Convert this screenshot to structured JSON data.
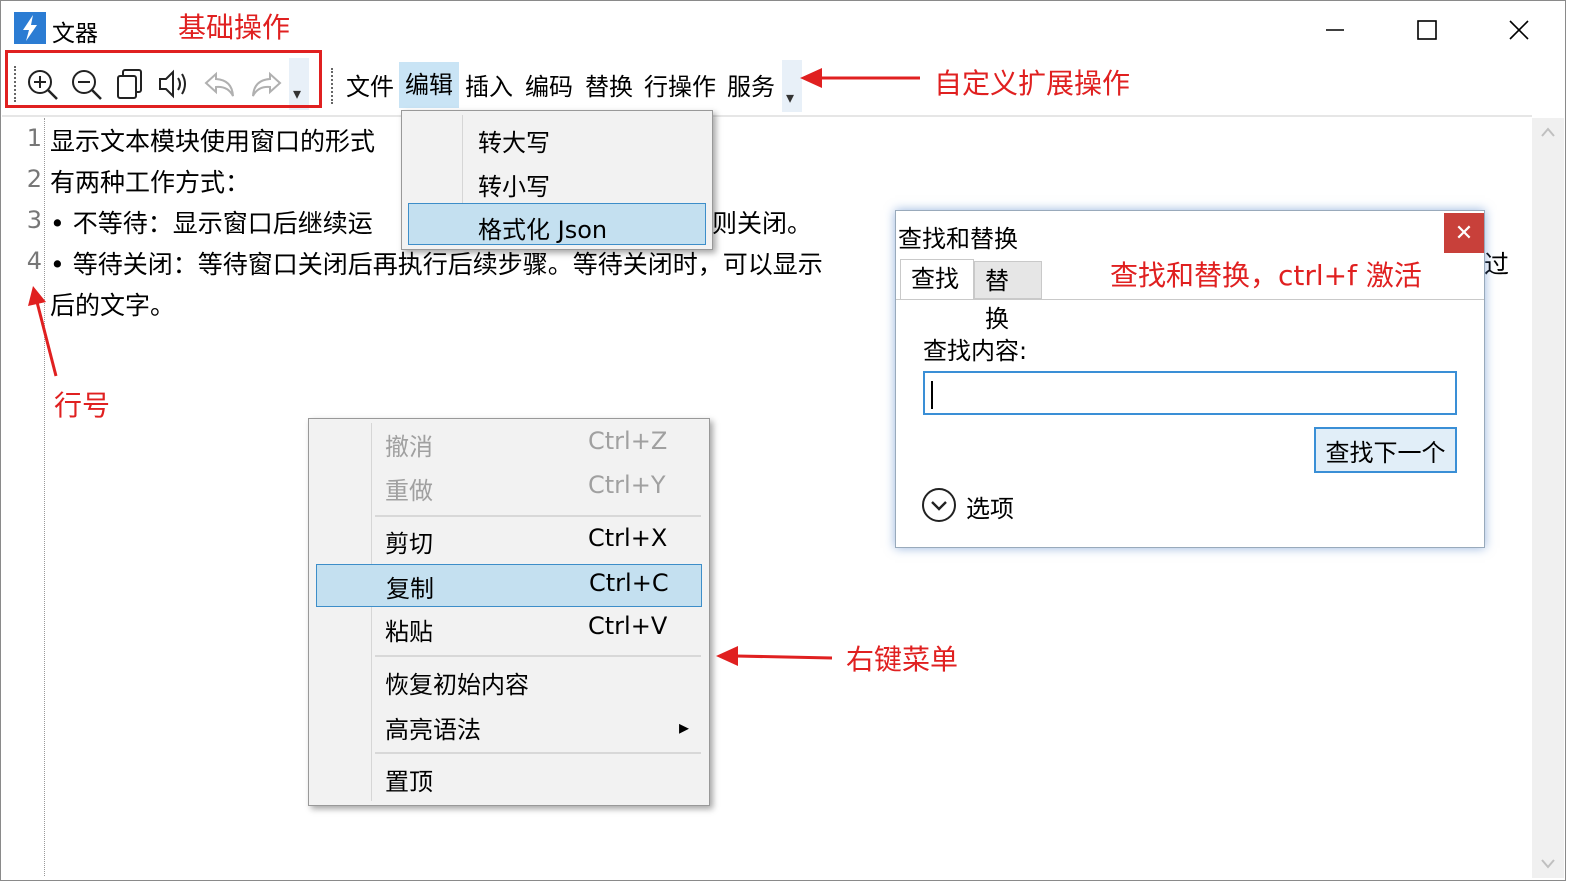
{
  "window": {
    "title": "文器",
    "minimize_glyph": "—",
    "maximize_glyph": "☐",
    "close_glyph": "✕"
  },
  "toolbar": {
    "icons": [
      "zoom-in-icon",
      "zoom-out-icon",
      "copy-icon",
      "speaker-icon",
      "undo-icon",
      "redo-icon"
    ],
    "overflow_glyph": "▾"
  },
  "menubar": {
    "items": [
      "文件",
      "编辑",
      "插入",
      "编码",
      "替换",
      "行操作",
      "服务"
    ],
    "active_index": 1
  },
  "edit_menu": {
    "items": [
      "转大写",
      "转小写",
      "格式化 Json"
    ],
    "highlighted_index": 2
  },
  "editor": {
    "line_numbers": [
      "1",
      "2",
      "3",
      "4"
    ],
    "lines": [
      "显示文本模块使用窗口的形式",
      "有两种工作方式：",
      "•  不等待：显示窗口后继续运",
      "•  等待关闭：等待窗口关闭后再执行后续步骤。等待关闭时，可以显示",
      "后的文字。"
    ],
    "line3_tail": "则关闭。",
    "line4_tail": "过"
  },
  "context_menu": {
    "groups": [
      [
        {
          "label": "撤消",
          "shortcut": "Ctrl+Z",
          "disabled": true
        },
        {
          "label": "重做",
          "shortcut": "Ctrl+Y",
          "disabled": true
        }
      ],
      [
        {
          "label": "剪切",
          "shortcut": "Ctrl+X"
        },
        {
          "label": "复制",
          "shortcut": "Ctrl+C",
          "highlighted": true
        },
        {
          "label": "粘贴",
          "shortcut": "Ctrl+V"
        }
      ],
      [
        {
          "label": "恢复初始内容",
          "shortcut": ""
        },
        {
          "label": "高亮语法",
          "shortcut": "",
          "submenu": true
        }
      ],
      [
        {
          "label": "置顶",
          "shortcut": ""
        }
      ]
    ],
    "submenu_glyph": "▸"
  },
  "find_dialog": {
    "title": "查找和替换",
    "close_glyph": "✕",
    "tabs": [
      "查找",
      "替换"
    ],
    "active_tab": 0,
    "find_label": "查找内容:",
    "find_value": "",
    "find_next_label": "查找下一个",
    "options_label": "选项"
  },
  "annotations": {
    "basic_ops": "基础操作",
    "custom_ext": "自定义扩展操作",
    "line_numbers": "行号",
    "find_replace": "查找和替换，ctrl+f 激活",
    "context_menu": "右键菜单"
  },
  "colors": {
    "annotation_red": "#e02020",
    "highlight_blue": "#c4e0f0",
    "accent_blue": "#3a8fd6",
    "close_red": "#c8403a"
  }
}
